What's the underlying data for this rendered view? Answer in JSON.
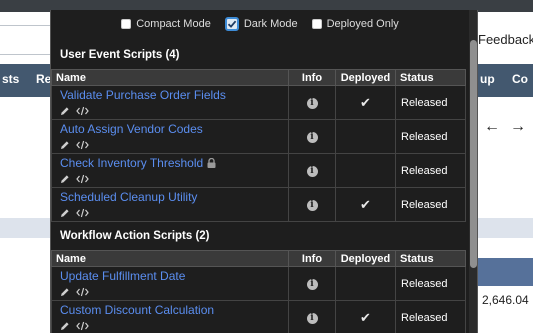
{
  "background": {
    "feedback_label": "Feedback",
    "nav_items": [
      "sts",
      "Re",
      "up",
      "Co"
    ],
    "arrow_icons": [
      "←",
      "→"
    ],
    "value_text": "2,646.04"
  },
  "toggles": [
    {
      "label": "Compact Mode",
      "checked": false
    },
    {
      "label": "Dark Mode",
      "checked": true
    },
    {
      "label": "Deployed Only",
      "checked": false
    }
  ],
  "columns": {
    "name": "Name",
    "info": "Info",
    "deployed": "Deployed",
    "status": "Status"
  },
  "sections": [
    {
      "title": "User Event Scripts (4)",
      "rows": [
        {
          "name": "Validate Purchase Order Fields",
          "deployed": "✔",
          "status": "Released",
          "locked": false
        },
        {
          "name": "Auto Assign Vendor Codes",
          "deployed": "",
          "status": "Released",
          "locked": false
        },
        {
          "name": "Check Inventory Threshold",
          "deployed": "",
          "status": "Released",
          "locked": true
        },
        {
          "name": "Scheduled Cleanup Utility",
          "deployed": "✔",
          "status": "Released",
          "locked": false
        }
      ]
    },
    {
      "title": "Workflow Action Scripts (2)",
      "rows": [
        {
          "name": "Update Fulfillment Date",
          "deployed": "",
          "status": "Released",
          "locked": false
        },
        {
          "name": "Custom Discount Calculation",
          "deployed": "✔",
          "status": "Released",
          "locked": false
        }
      ]
    }
  ],
  "icons": {
    "edit": "pencil-icon",
    "code": "code-icon",
    "info": "info-icon",
    "lock": "lock-icon"
  },
  "colors": {
    "link": "#5b8ef0",
    "panel": "#1e1e1e",
    "header": "#3a3a3a",
    "accent": "#3d8bd6"
  }
}
